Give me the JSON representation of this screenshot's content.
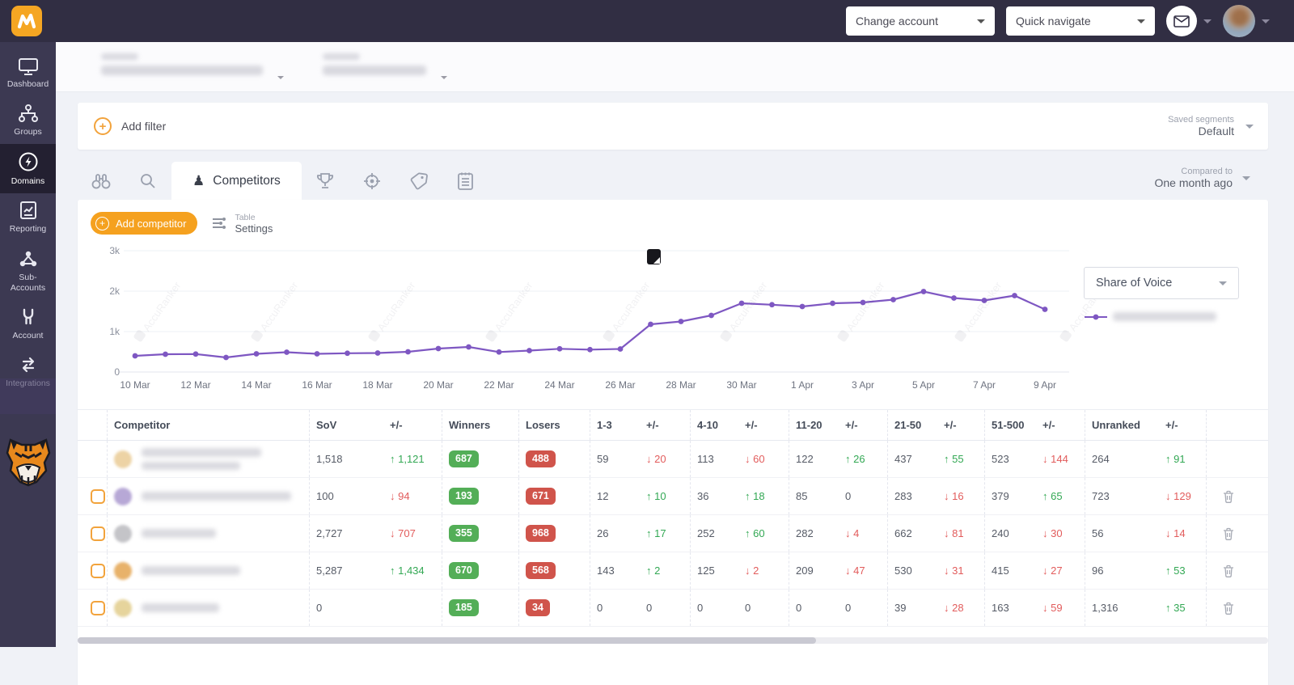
{
  "colors": {
    "accent_orange": "#f2a33c",
    "button_orange": "#f5a11f",
    "chart_purple": "#7e57c2",
    "green": "#33a854",
    "red": "#e25c5c",
    "badge_green": "#53ae57",
    "badge_red": "#d0544b"
  },
  "topbar": {
    "change_account": "Change account",
    "quick_navigate": "Quick navigate"
  },
  "sidebar": {
    "items": [
      {
        "label": "Dashboard",
        "icon": "monitor-icon",
        "active": false
      },
      {
        "label": "Groups",
        "icon": "sitemap-icon",
        "active": false
      },
      {
        "label": "Domains",
        "icon": "bolt-circle-icon",
        "active": true
      },
      {
        "label": "Reporting",
        "icon": "report-icon",
        "active": false
      },
      {
        "label": "Sub-Accounts",
        "icon": "nodes-icon",
        "active": false
      },
      {
        "label": "Account",
        "icon": "wrench-icon",
        "active": false
      },
      {
        "label": "Integrations",
        "icon": "swap-arrows-icon",
        "active": false
      }
    ]
  },
  "filters": {
    "add_filter": "Add filter",
    "saved_segments_label": "Saved segments",
    "saved_segments_value": "Default"
  },
  "tabs": {
    "icons": [
      "binoculars-icon",
      "search-icon",
      "pawn-icon",
      "trophy-icon",
      "target-icon",
      "tag-icon",
      "notes-icon"
    ],
    "active_label": "Competitors",
    "compared_label": "Compared to",
    "compared_value": "One month ago"
  },
  "toolbar": {
    "add_competitor": "Add competitor",
    "table_label": "Table",
    "settings_label": "Settings"
  },
  "chart_controls": {
    "metric": "Share of Voice"
  },
  "chart_data": {
    "type": "line",
    "title": "Share of Voice",
    "x": [
      "10 Mar",
      "11 Mar",
      "12 Mar",
      "13 Mar",
      "14 Mar",
      "15 Mar",
      "16 Mar",
      "17 Mar",
      "18 Mar",
      "19 Mar",
      "20 Mar",
      "21 Mar",
      "22 Mar",
      "23 Mar",
      "24 Mar",
      "25 Mar",
      "26 Mar",
      "27 Mar",
      "28 Mar",
      "29 Mar",
      "30 Mar",
      "31 Mar",
      "1 Apr",
      "2 Apr",
      "3 Apr",
      "4 Apr",
      "5 Apr",
      "6 Apr",
      "7 Apr",
      "8 Apr",
      "9 Apr"
    ],
    "xticks": [
      "10 Mar",
      "12 Mar",
      "14 Mar",
      "16 Mar",
      "18 Mar",
      "20 Mar",
      "22 Mar",
      "24 Mar",
      "26 Mar",
      "28 Mar",
      "30 Mar",
      "1 Apr",
      "3 Apr",
      "5 Apr",
      "7 Apr",
      "9 Apr"
    ],
    "yticks": [
      "0",
      "1k",
      "2k",
      "3k"
    ],
    "ylim": [
      0,
      3000
    ],
    "grid": true,
    "legend_position": "right",
    "annotation": {
      "type": "note-marker",
      "x": "27 Mar"
    },
    "series": [
      {
        "name": "competitor-domain (redacted)",
        "color": "#7e57c2",
        "values": [
          400,
          440,
          445,
          360,
          450,
          490,
          450,
          465,
          470,
          500,
          580,
          620,
          495,
          530,
          575,
          555,
          570,
          1180,
          1250,
          1400,
          1700,
          1665,
          1620,
          1700,
          1720,
          1790,
          1990,
          1830,
          1770,
          1890,
          1550
        ]
      }
    ]
  },
  "table": {
    "columns": [
      "Competitor",
      "SoV",
      "+/-",
      "Winners",
      "Losers",
      "1-3",
      "+/-",
      "4-10",
      "+/-",
      "11-20",
      "+/-",
      "21-50",
      "+/-",
      "51-500",
      "+/-",
      "Unranked",
      "+/-"
    ],
    "rows": [
      {
        "checkbox": false,
        "deletable": false,
        "favicon": "#edd3a5",
        "name_w": 148,
        "domain_w": 122,
        "cells": [
          {
            "t": "1,518"
          },
          {
            "d": "up",
            "t": "1,121"
          },
          {
            "b": "green",
            "t": "687"
          },
          {
            "b": "red",
            "t": "488"
          },
          {
            "t": "59"
          },
          {
            "d": "down",
            "t": "20"
          },
          {
            "t": "113"
          },
          {
            "d": "down",
            "t": "60"
          },
          {
            "t": "122"
          },
          {
            "d": "up",
            "t": "26"
          },
          {
            "t": "437"
          },
          {
            "d": "up",
            "t": "55"
          },
          {
            "t": "523"
          },
          {
            "d": "down",
            "t": "144"
          },
          {
            "t": "264"
          },
          {
            "d": "up",
            "t": "91"
          }
        ]
      },
      {
        "checkbox": true,
        "deletable": true,
        "favicon": "#b7a8d6",
        "name_w": 185,
        "domain_w": 0,
        "cells": [
          {
            "t": "100"
          },
          {
            "d": "down",
            "t": "94"
          },
          {
            "b": "green",
            "t": "193"
          },
          {
            "b": "red",
            "t": "671"
          },
          {
            "t": "12"
          },
          {
            "d": "up",
            "t": "10"
          },
          {
            "t": "36"
          },
          {
            "d": "up",
            "t": "18"
          },
          {
            "t": "85"
          },
          {
            "t": "0"
          },
          {
            "t": "283"
          },
          {
            "d": "down",
            "t": "16"
          },
          {
            "t": "379"
          },
          {
            "d": "up",
            "t": "65"
          },
          {
            "t": "723"
          },
          {
            "d": "down",
            "t": "129"
          }
        ]
      },
      {
        "checkbox": true,
        "deletable": true,
        "favicon": "#c4c4c8",
        "name_w": 92,
        "domain_w": 0,
        "cells": [
          {
            "t": "2,727"
          },
          {
            "d": "down",
            "t": "707"
          },
          {
            "b": "green",
            "t": "355"
          },
          {
            "b": "red",
            "t": "968"
          },
          {
            "t": "26"
          },
          {
            "d": "up",
            "t": "17"
          },
          {
            "t": "252"
          },
          {
            "d": "up",
            "t": "60"
          },
          {
            "t": "282"
          },
          {
            "d": "down",
            "t": "4"
          },
          {
            "t": "662"
          },
          {
            "d": "down",
            "t": "81"
          },
          {
            "t": "240"
          },
          {
            "d": "down",
            "t": "30"
          },
          {
            "t": "56"
          },
          {
            "d": "down",
            "t": "14"
          }
        ]
      },
      {
        "checkbox": true,
        "deletable": true,
        "favicon": "#e8b26a",
        "name_w": 122,
        "domain_w": 0,
        "cells": [
          {
            "t": "5,287"
          },
          {
            "d": "up",
            "t": "1,434"
          },
          {
            "b": "green",
            "t": "670"
          },
          {
            "b": "red",
            "t": "568"
          },
          {
            "t": "143"
          },
          {
            "d": "up",
            "t": "2"
          },
          {
            "t": "125"
          },
          {
            "d": "down",
            "t": "2"
          },
          {
            "t": "209"
          },
          {
            "d": "down",
            "t": "47"
          },
          {
            "t": "530"
          },
          {
            "d": "down",
            "t": "31"
          },
          {
            "t": "415"
          },
          {
            "d": "down",
            "t": "27"
          },
          {
            "t": "96"
          },
          {
            "d": "up",
            "t": "53"
          }
        ]
      },
      {
        "checkbox": true,
        "deletable": true,
        "favicon": "#e6d49c",
        "name_w": 96,
        "domain_w": 0,
        "cells": [
          {
            "t": "0"
          },
          {
            "t": ""
          },
          {
            "b": "green",
            "t": "185"
          },
          {
            "b": "red",
            "t": "34"
          },
          {
            "t": "0"
          },
          {
            "t": "0"
          },
          {
            "t": "0"
          },
          {
            "t": "0"
          },
          {
            "t": "0"
          },
          {
            "t": "0"
          },
          {
            "t": "39"
          },
          {
            "d": "down",
            "t": "28"
          },
          {
            "t": "163"
          },
          {
            "d": "down",
            "t": "59"
          },
          {
            "t": "1,316"
          },
          {
            "d": "up",
            "t": "35"
          }
        ]
      }
    ]
  }
}
